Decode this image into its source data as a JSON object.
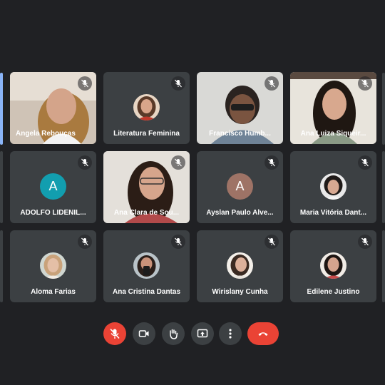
{
  "participants": [
    {
      "name": "Ângela Rebouças",
      "muted": true
    },
    {
      "name": "Literatura Feminina",
      "muted": true
    },
    {
      "name": "Francisco Humb...",
      "muted": true
    },
    {
      "name": "Ana Luiza Siqueir...",
      "muted": true
    },
    {
      "name": "ADOLFO LIDENIL...",
      "muted": true,
      "avatar_letter": "A",
      "avatar_color": "#129eaf"
    },
    {
      "name": "Ana Clara de Sou...",
      "muted": true
    },
    {
      "name": "Ayslan Paulo Alve...",
      "muted": true,
      "avatar_letter": "A",
      "avatar_color": "#9e7366"
    },
    {
      "name": "Maria Vitória Dant...",
      "muted": true
    },
    {
      "name": "Aloma Farias",
      "muted": true
    },
    {
      "name": "Ana Cristina Dantas",
      "muted": true
    },
    {
      "name": "Wirislany Cunha",
      "muted": true
    },
    {
      "name": "Edilene Justino",
      "muted": true
    }
  ],
  "controls": [
    "mic-off-icon",
    "camera-icon",
    "raise-hand-icon",
    "present-screen-icon",
    "more-options-icon",
    "hang-up-icon"
  ],
  "colors": {
    "background": "#202124",
    "tile": "#3c4043",
    "accent_red": "#ea4335",
    "active_speaker": "#8ab4f8"
  }
}
